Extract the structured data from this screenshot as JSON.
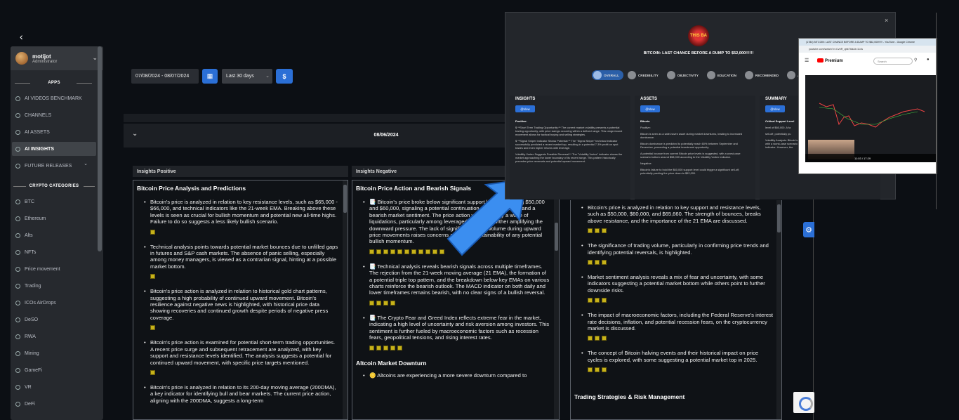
{
  "sidebar": {
    "user": {
      "name": "motijot",
      "role": "Administrator"
    },
    "apps_label": "APPS",
    "apps": [
      {
        "label": "AI VIDEOS BENCHMARK",
        "icon": "search-icon"
      },
      {
        "label": "CHANNELS",
        "icon": "search-icon"
      },
      {
        "label": "AI ASSETS",
        "icon": "eye-icon"
      },
      {
        "label": "AI INSIGHTS",
        "icon": "eye-icon",
        "active": true
      },
      {
        "label": "FUTURE RELEASES",
        "icon": "clock-icon"
      }
    ],
    "crypto_label": "CRYPTO CATEGORIES",
    "categories": [
      "BTC",
      "Ethereum",
      "Alts",
      "NFTs",
      "Price movement",
      "Trading",
      "ICOs AirDrops",
      "DeSO",
      "RWA",
      "Mining",
      "GameFi",
      "VR",
      "DeFi"
    ]
  },
  "filters": {
    "date_range": "07/08/2024 - 08/07/2024",
    "period": "Last 30 days",
    "currency_button": "$"
  },
  "date_header": "08/06/2024",
  "columns": [
    {
      "header": "Insights Positive",
      "title": "Bitcoin Price Analysis and Predictions",
      "bullets": [
        {
          "text": "Bitcoin's price is analyzed in relation to key resistance levels, such as $65,000 - $66,000, and technical indicators like the 21-week EMA. Breaking above these levels is seen as crucial for bullish momentum and potential new all-time highs. Failure to do so suggests a less likely bullish scenario.",
          "emojis": 1
        },
        {
          "text": "Technical analysis points towards potential market bounces due to unfilled gaps in futures and S&P cash markets. The absence of panic selling, especially among money managers, is viewed as a contrarian signal, hinting at a possible market bottom.",
          "emojis": 1
        },
        {
          "text": "Bitcoin's price action is analyzed in relation to historical gold chart patterns, suggesting a high probability of continued upward movement. Bitcoin's resilience against negative news is highlighted, with historical price data showing recoveries and continued growth despite periods of negative press coverage.",
          "emojis": 1
        },
        {
          "text": "Bitcoin's price action is examined for potential short-term trading opportunities. A recent price surge and subsequent retracement are analyzed, with key support and resistance levels identified. The analysis suggests a potential for continued upward movement, with specific price targets mentioned.",
          "emojis": 1
        },
        {
          "text": "Bitcoin's price is analyzed in relation to its 200-day moving average (200DMA), a key indicator for identifying bull and bear markets. The current price action, aligning with the 200DMA, suggests a long-term",
          "emojis": 0
        }
      ]
    },
    {
      "header": "Insights Negative",
      "title": "Bitcoin Price Action and Bearish Signals",
      "bullets": [
        {
          "text": "📑 Bitcoin's price broke below significant support levels, including $50,000 and $60,000, signaling a potential continuation of the downtrend and a bearish market sentiment. The price action was driven by a wave of liquidations, particularly among leveraged positions, further amplifying the downward pressure. The lack of significant buying volume during upward price movements raises concerns about the sustainability of any potential bullish momentum.",
          "emojis": 11
        },
        {
          "text": "📑 Technical analysis reveals bearish signals across multiple timeframes. The rejection from the 21-week moving average (21 EMA), the formation of a potential triple top pattern, and the breakdown below key EMAs on various charts reinforce the bearish outlook. The MACD indicator on both daily and lower timeframes remains bearish, with no clear signs of a bullish reversal.",
          "emojis": 4
        },
        {
          "text": "📑 The Crypto Fear and Greed Index reflects extreme fear in the market, indicating a high level of uncertainty and risk aversion among investors. This sentiment is further fueled by macroeconomic factors such as recession fears, geopolitical tensions, and rising interest rates.",
          "emojis": 5
        }
      ],
      "subsection": "Altcoin Market Downturn",
      "sub_bullet": "🪙 Altcoins are experiencing a more severe downturn compared to"
    },
    {
      "header": "",
      "title": "",
      "bullets": [
        {
          "text": "Bitcoin's price is analyzed in relation to key support and resistance levels, such as $50,000, $60,000, and $65,660. The strength of bounces, breaks above resistance, and the importance of the 21 EMA are discussed.",
          "emojis": 3
        },
        {
          "text": "The significance of trading volume, particularly in confirming price trends and identifying potential reversals, is highlighted.",
          "emojis": 3
        },
        {
          "text": "Market sentiment analysis reveals a mix of fear and uncertainty, with some indicators suggesting a potential market bottom while others point to further downside risks.",
          "emojis": 3
        },
        {
          "text": "The impact of macroeconomic factors, including the Federal Reserve's interest rate decisions, inflation, and potential recession fears, on the cryptocurrency market is discussed.",
          "emojis": 3
        },
        {
          "text": "The concept of Bitcoin halving events and their historical impact on price cycles is explored, with some suggesting a potential market top in 2025.",
          "emojis": 3
        }
      ],
      "subsection": "Trading Strategies & Risk Management"
    }
  ],
  "overlay": {
    "logo_text": "THIS BA",
    "title": "BITCOIN: LAST CHANCE BEFORE A DUMP TO $52,000!!!!!!",
    "tabs": [
      "OVERALL",
      "CREDIBILITY",
      "OBJECTIVITY",
      "EDUCATION",
      "RECOMENDED",
      "ACCURA"
    ],
    "sections": [
      {
        "heading": "INSIGHTS",
        "button": "@View",
        "label": "Positive:",
        "lines": [
          "$ **Short Term Trading Opportunity:** The current market volatility presents a potential trading opportunity, with price swings occurring within a defined range. This range-bound movement allows for tactical buying and selling strategies.",
          "$ **Signal Sniper Indicator Shows Potential:** The \"Signal Sniper\" technical indicator successfully predicted a recent market top, resulting in a potential 7-3% profit on spot trades and even higher returns with leverage.",
          "Volatility Vortex Suggests Possible Reversal:** The \"Volatility Vortex\" indicator shows the market approaching the lower boundary of its recent range. This pattern historically precedes price reversals and potential upward movement."
        ]
      },
      {
        "heading": "ASSETS",
        "button": "@View",
        "label": "Bitcoin",
        "lines": [
          "Positive:",
          "Bitcoin is seen as a safe-haven asset during market downturns, leading to increased dominance.",
          "Bitcoin dominance is predicted to potentially reach 60% between September and December, presenting a potential investment opportunity.",
          "A potential bounce from current Bitcoin price levels is suggested, with a worst-case scenario bottom around $58,000 according to the Volatility Vortex indicator.",
          "Negative:",
          "Bitcoin's failure to hold the $60,000 support level could trigger a significant sell-off, potentially pushing the price down to $52,000."
        ]
      },
      {
        "heading": "SUMMARY",
        "button": "@View",
        "label": "Critical Support Level",
        "lines": [
          "level of $60,000. A fa",
          "sell-off, potentially pu",
          "Volatility Analysis: Bitcoin's price action suggests a potential bounce from current levels, with a worst-case scenario bottom around $58,000 according to the Volatility Vortex indicator. However, the"
        ]
      }
    ]
  },
  "youtube": {
    "window_title": "(1784) BITCOIN: LAST CHANCE BEFORE A DUMP TO $52,000!!!!!! - YouTube - Google Chrome",
    "url": "youtube.com/watch?v=CvbR_qbkT6d&t=114s",
    "logo": "Premium",
    "search_placeholder": "Search",
    "time": "11:03 / 17:29"
  },
  "colors": {
    "accent": "#2b6fd6",
    "emoji": "#c7b21a",
    "arrow": "#3b8ef0"
  }
}
